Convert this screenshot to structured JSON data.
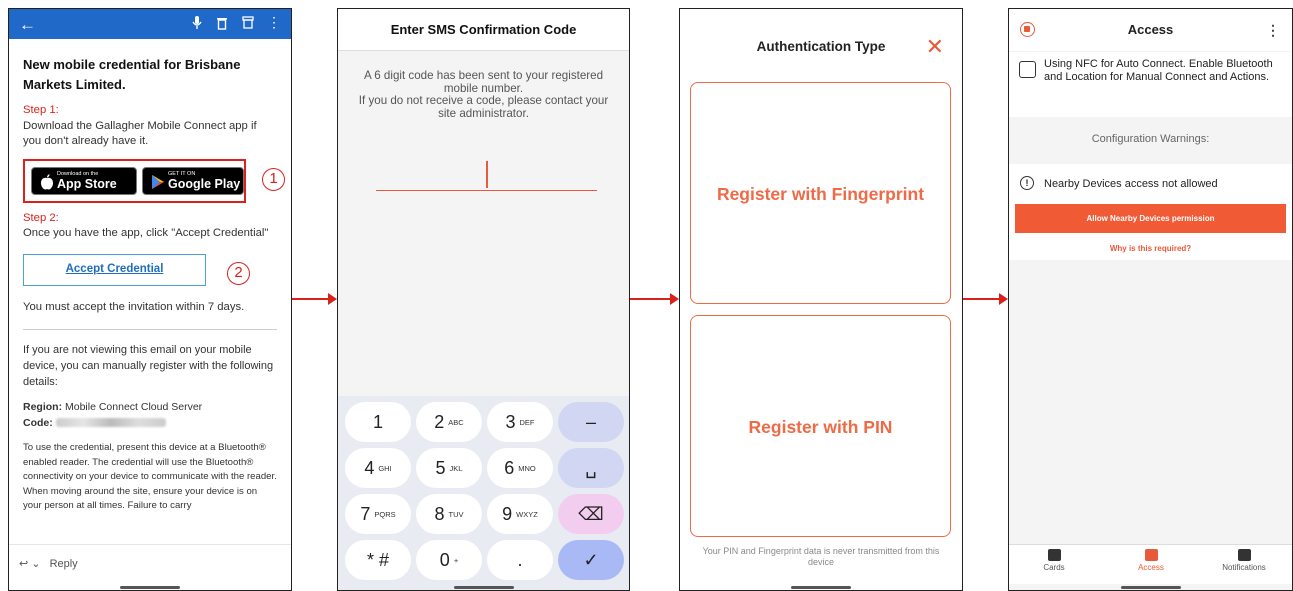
{
  "email": {
    "heading": "New mobile credential for Brisbane Markets Limited.",
    "step1_label": "Step 1:",
    "step1_text": "Download the Gallagher Mobile Connect app if you don't already have it.",
    "appstore_small": "Download on the",
    "appstore_big": "App Store",
    "googleplay_small": "GET IT ON",
    "googleplay_big": "Google Play",
    "marker1": "1",
    "step2_label": "Step 2:",
    "step2_text": "Once you have the app, click \"Accept Credential\"",
    "accept_button": "Accept Credential",
    "marker2": "2",
    "accept_note": "You must accept the invitation within 7 days.",
    "manual_text": "If you are not viewing this email on your mobile device, you can manually register with the following details:",
    "region_label": "Region:",
    "region_value": "Mobile Connect Cloud Server",
    "code_label": "Code:",
    "usage_text": "To use the credential, present this device at a Bluetooth® enabled reader. The credential will use the Bluetooth® connectivity on your device to communicate with the reader. When moving around the site, ensure your device is on your person at all times. Failure to carry",
    "reply_label": "Reply"
  },
  "sms": {
    "title": "Enter SMS Confirmation Code",
    "message": "A 6 digit code has been sent to your registered mobile number.\nIf you do not receive a code, please contact your site administrator.",
    "keys": [
      {
        "main": "1",
        "sub": ""
      },
      {
        "main": "2",
        "sub": "ABC"
      },
      {
        "main": "3",
        "sub": "DEF"
      },
      {
        "main": "–",
        "sub": ""
      },
      {
        "main": "4",
        "sub": "GHI"
      },
      {
        "main": "5",
        "sub": "JKL"
      },
      {
        "main": "6",
        "sub": "MNO"
      },
      {
        "main": "␣",
        "sub": ""
      },
      {
        "main": "7",
        "sub": "PQRS"
      },
      {
        "main": "8",
        "sub": "TUV"
      },
      {
        "main": "9",
        "sub": "WXYZ"
      },
      {
        "main": "⌫",
        "sub": ""
      },
      {
        "main": "* #",
        "sub": ""
      },
      {
        "main": "0",
        "sub": "+"
      },
      {
        "main": ".",
        "sub": ""
      },
      {
        "main": "✓",
        "sub": ""
      }
    ]
  },
  "auth": {
    "title": "Authentication Type",
    "close_glyph": "✕",
    "fingerprint_button": "Register with Fingerprint",
    "pin_button": "Register with PIN",
    "note": "Your PIN and Fingerprint data is never transmitted from this device"
  },
  "access": {
    "title": "Access",
    "more_glyph": "⋮",
    "nfc_text": "Using NFC for Auto Connect. Enable Bluetooth and Location for Manual Connect and Actions.",
    "warnings_title": "Configuration Warnings:",
    "warning_text": "Nearby Devices access not allowed",
    "warning_glyph": "!",
    "allow_button": "Allow Nearby Devices permission",
    "why_link": "Why is this required?",
    "tabs": [
      {
        "label": "Cards"
      },
      {
        "label": "Access"
      },
      {
        "label": "Notifications"
      }
    ]
  },
  "colors": {
    "accent": "#f05b36",
    "email_blue": "#2169c9",
    "annotation_red": "#d9221c"
  }
}
